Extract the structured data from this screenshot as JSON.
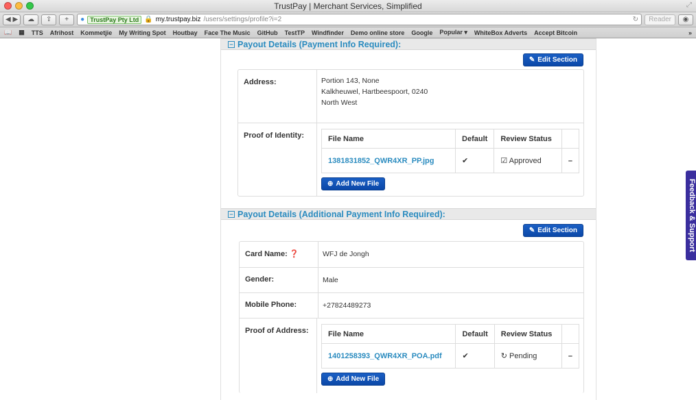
{
  "window": {
    "title": "TrustPay | Merchant Services, Simplified"
  },
  "toolbar": {
    "ev_label": "TrustPay Pty Ltd",
    "url_host": "my.trustpay.biz",
    "url_path": "/users/settings/profile?i=2",
    "reader": "Reader"
  },
  "bookmarks": [
    "TTS",
    "Afrihost",
    "Kommetjie",
    "My Writing Spot",
    "Houtbay",
    "Face The Music",
    "GitHub",
    "TestTP",
    "Windfinder",
    "Demo online store",
    "Google",
    "Popular ▾",
    "WhiteBox Adverts",
    "Accept Bitcoin"
  ],
  "section1": {
    "title": "Payout Details (Payment Info Required):",
    "edit_label": "Edit Section",
    "address_label": "Address:",
    "address_line1": "Portion 143, None",
    "address_line2": "Kalkheuwel, Hartbeespoort, 0240",
    "address_line3": "North West",
    "poi_label": "Proof of Identity:",
    "columns": [
      "File Name",
      "Default",
      "Review Status"
    ],
    "file_name": "1381831852_QWR4XR_PP.jpg",
    "default_mark": "✔",
    "status": "Approved",
    "remove": "–",
    "add_file": "Add New File"
  },
  "section2": {
    "title": "Payout Details (Additional Payment Info Required):",
    "edit_label": "Edit Section",
    "card_name_label": "Card Name:",
    "card_name": "WFJ de Jongh",
    "gender_label": "Gender:",
    "gender": "Male",
    "mobile_label": "Mobile Phone:",
    "mobile": "+27824489273",
    "poa_label": "Proof of Address:",
    "columns": [
      "File Name",
      "Default",
      "Review Status"
    ],
    "file_name": "1401258393_QWR4XR_POA.pdf",
    "default_mark": "✔",
    "status": "Pending",
    "remove": "–",
    "add_file": "Add New File"
  },
  "feedback": {
    "label": "Feedback & Support"
  }
}
